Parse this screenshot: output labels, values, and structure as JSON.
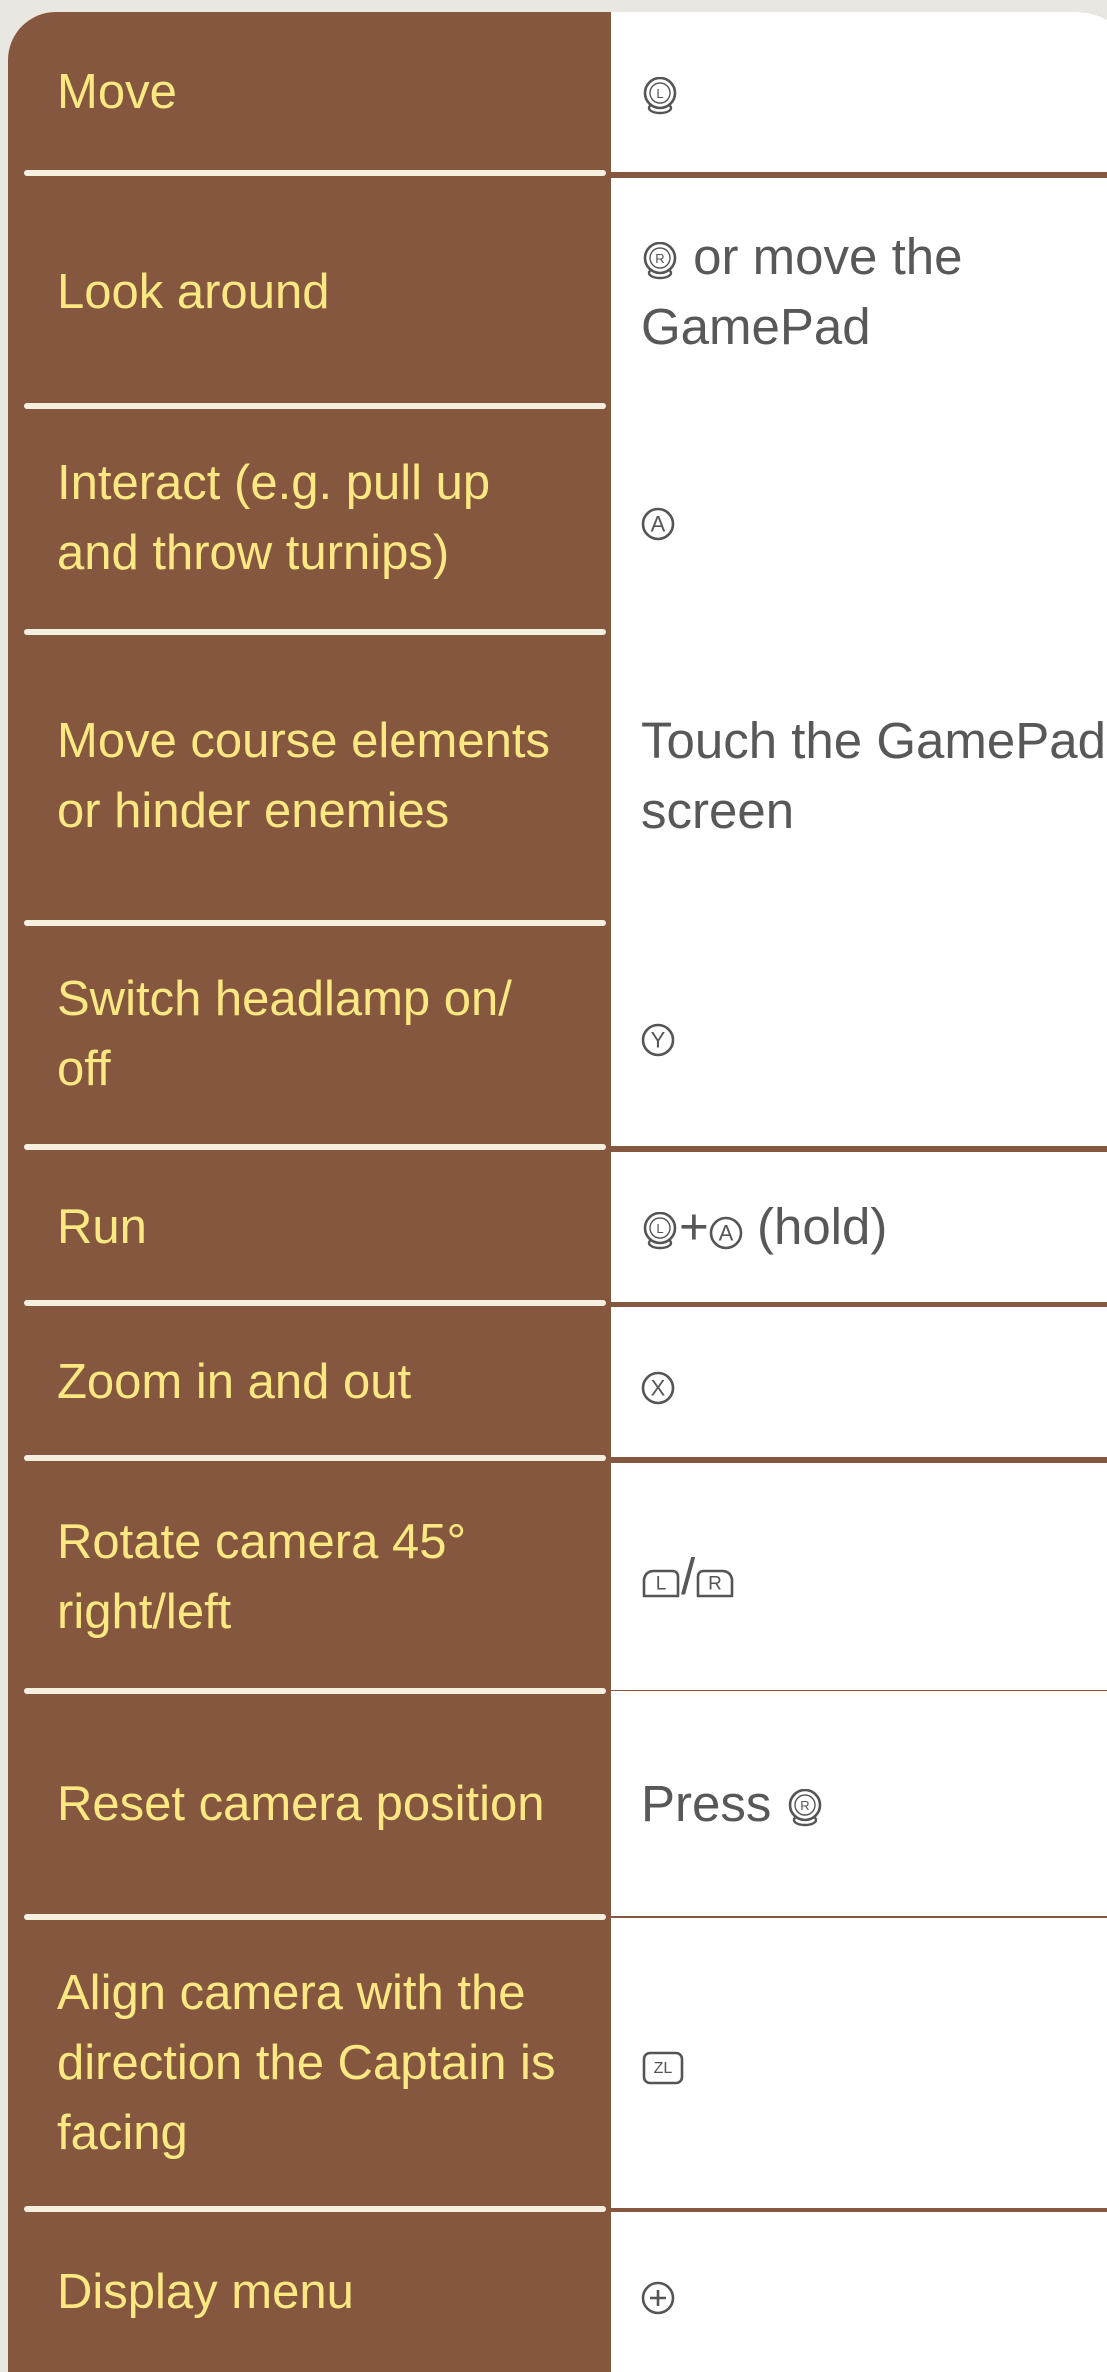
{
  "controls": [
    {
      "action": "Move",
      "input": [
        {
          "icon": "l-stick-icon"
        }
      ]
    },
    {
      "action": "Look around",
      "input": [
        {
          "icon": "r-stick-icon"
        },
        {
          "text": " or move the GamePad"
        }
      ]
    },
    {
      "action": "Interact (e.g. pull up and throw turnips)",
      "input": [
        {
          "icon": "a-button-icon"
        }
      ]
    },
    {
      "action": "Move course elements or hinder enemies",
      "input": [
        {
          "text": "Touch the GamePad screen"
        }
      ]
    },
    {
      "action": "Switch headlamp on/ off",
      "input": [
        {
          "icon": "y-button-icon"
        }
      ]
    },
    {
      "action": "Run",
      "input": [
        {
          "icon": "l-stick-icon"
        },
        {
          "text": "+"
        },
        {
          "icon": "a-button-icon"
        },
        {
          "text": " (hold)"
        }
      ]
    },
    {
      "action": "Zoom in and out",
      "input": [
        {
          "icon": "x-button-icon"
        }
      ]
    },
    {
      "action": "Rotate camera 45° right/left",
      "input": [
        {
          "icon": "l-shoulder-icon"
        },
        {
          "text": "/"
        },
        {
          "icon": "r-shoulder-icon"
        }
      ]
    },
    {
      "action": "Reset camera position",
      "input": [
        {
          "text": "Press "
        },
        {
          "icon": "r-stick-icon"
        }
      ]
    },
    {
      "action": "Align camera with the direction the Captain is facing",
      "input": [
        {
          "icon": "zl-button-icon"
        }
      ]
    },
    {
      "action": "Display menu",
      "input": [
        {
          "icon": "plus-button-icon"
        }
      ]
    }
  ],
  "colors": {
    "frame_brown": "#85573f",
    "label_yellow": "#fbe882",
    "value_gray": "#585858",
    "separator": "#f4efdf"
  }
}
